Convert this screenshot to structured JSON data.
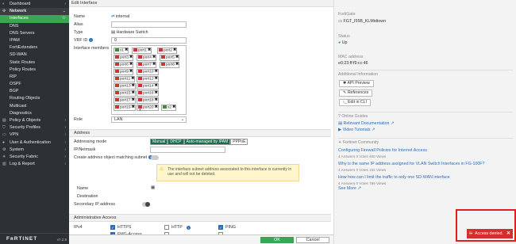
{
  "sidebar": {
    "items": [
      {
        "label": "Dashboard",
        "icon": "dashboard-icon"
      },
      {
        "label": "Network",
        "icon": "network-icon"
      },
      {
        "label": "Interfaces",
        "active": true
      },
      {
        "label": "DNS"
      },
      {
        "label": "DNS Servers"
      },
      {
        "label": "IPAM"
      },
      {
        "label": "FortiExtenders"
      },
      {
        "label": "SD-WAN"
      },
      {
        "label": "Static Routes"
      },
      {
        "label": "Policy Routes"
      },
      {
        "label": "RIP"
      },
      {
        "label": "OSPF"
      },
      {
        "label": "BGP"
      },
      {
        "label": "Routing Objects"
      },
      {
        "label": "Multicast"
      },
      {
        "label": "Diagnostics"
      },
      {
        "label": "Policy & Objects",
        "icon": "policy-icon"
      },
      {
        "label": "Security Profiles",
        "icon": "shield-icon"
      },
      {
        "label": "VPN",
        "icon": "vpn-icon"
      },
      {
        "label": "User & Authentication",
        "icon": "user-icon"
      },
      {
        "label": "System",
        "icon": "gear-icon"
      },
      {
        "label": "Security Fabric",
        "icon": "fabric-icon"
      },
      {
        "label": "Log & Report",
        "icon": "log-icon"
      }
    ],
    "logo": "FʀRTINET",
    "version": "v7.2.8"
  },
  "panel": {
    "title": "Edit Interface",
    "fields": {
      "name_label": "Name",
      "name_value": "internal",
      "alias_label": "Alias",
      "type_label": "Type",
      "type_value": "Hardware Switch",
      "vrf_label": "VRF ID",
      "vrf_value": "0",
      "members_label": "Interface members",
      "role_label": "Role",
      "role_value": "LAN"
    },
    "members": [
      "x1",
      "port1",
      "port2",
      "port3",
      "port4",
      "port5",
      "port6",
      "port7",
      "port8",
      "port9",
      "port10",
      "port11",
      "port12",
      "port13",
      "port14",
      "port15",
      "port16",
      "port17",
      "port18",
      "port19",
      "port20",
      "x2"
    ],
    "add_member": "+",
    "address": {
      "section": "Address",
      "mode_label": "Addressing mode",
      "mode_options": [
        "Manual",
        "DHCP",
        "Auto-managed by IPAM",
        "PPPoE"
      ],
      "ipmask_label": "IP/Netmask",
      "create_label": "Create address object matching subnet",
      "warning": "The interface subnet address associated to this interface is currently in use and will not be deleted.",
      "name_label": "Name",
      "dest_label": "Destination",
      "secondary_label": "Secondary IP address"
    },
    "admin": {
      "section": "Administrative Access",
      "ipv4_label": "IPv4",
      "https": "HTTPS",
      "http": "HTTP",
      "ping": "PING",
      "more": "FMG-Access"
    },
    "ok": "OK",
    "cancel": "Cancel"
  },
  "right": {
    "fortigate_hdr": "FortiGate",
    "fortigate_name": "FGT_I55B_KLMidtown",
    "status_hdr": "Status",
    "status_value": "Up",
    "mac_hdr": "MAC address",
    "mac_value": "e0:23:ff:f9:cc:46",
    "addl_hdr": "Additional Information",
    "api_preview": "API Preview",
    "references": "References",
    "edit_cli": "Edit in CLI",
    "guides_hdr": "Online Guides",
    "relevant_doc": "Relevant Documentation",
    "video_tut": "Video Tutorials",
    "community_hdr": "Fortinet Community",
    "articles": [
      {
        "title": "Configuring Firewall Policies for Internet Access",
        "meta": "4 Answers  0 Votes  400 Views"
      },
      {
        "title": "Why is the same IP address assigned for VLAN Switch Interfaces in FG-100F?",
        "meta": "4 Answers  0 Votes  152 Views"
      },
      {
        "title": "How how can I limit the traffic to only one SD-WAN interface",
        "meta": "4 Answers  0 Votes  799 Views"
      }
    ],
    "see_more": "See More"
  },
  "toast": {
    "message": "Access denied."
  },
  "colors": {
    "accent": "#3aa655",
    "sidebar_bg": "#2d3135",
    "error": "#d62e2e",
    "link": "#2a6ebb"
  }
}
